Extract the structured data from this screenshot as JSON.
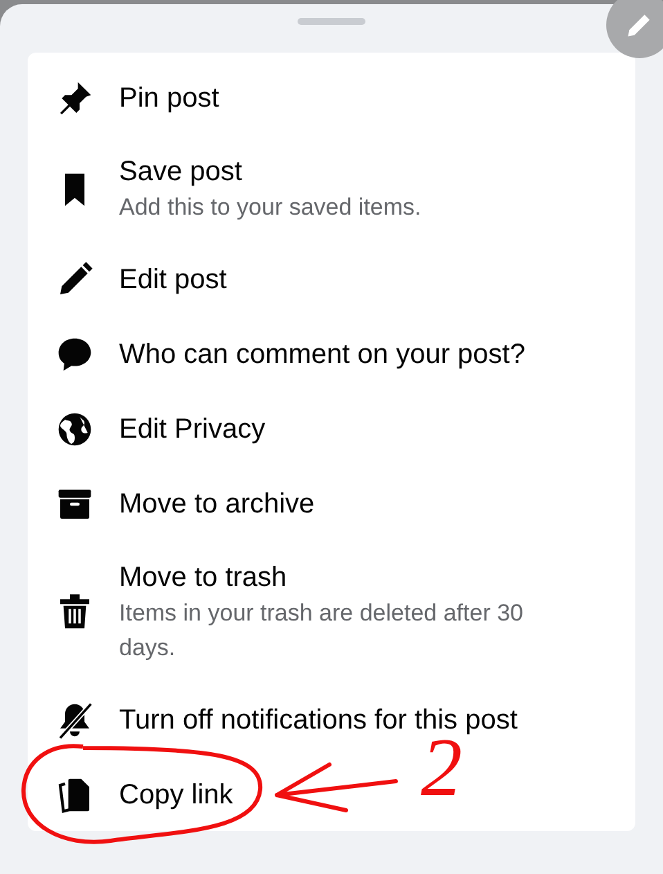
{
  "menu_items": [
    {
      "kind": "pin",
      "title": "Pin post"
    },
    {
      "kind": "bookmark",
      "title": "Save post",
      "subtitle": "Add this to your saved items."
    },
    {
      "kind": "pencil",
      "title": "Edit post"
    },
    {
      "kind": "speech",
      "title": "Who can comment on your post?"
    },
    {
      "kind": "globe",
      "title": "Edit Privacy"
    },
    {
      "kind": "archive",
      "title": "Move to archive"
    },
    {
      "kind": "trash",
      "title": "Move to trash",
      "subtitle": "Items in your trash are deleted after 30 days."
    },
    {
      "kind": "bell-off",
      "title": "Turn off notifications for this post"
    },
    {
      "kind": "copy",
      "title": "Copy link"
    }
  ],
  "annotation": {
    "number": "2"
  }
}
